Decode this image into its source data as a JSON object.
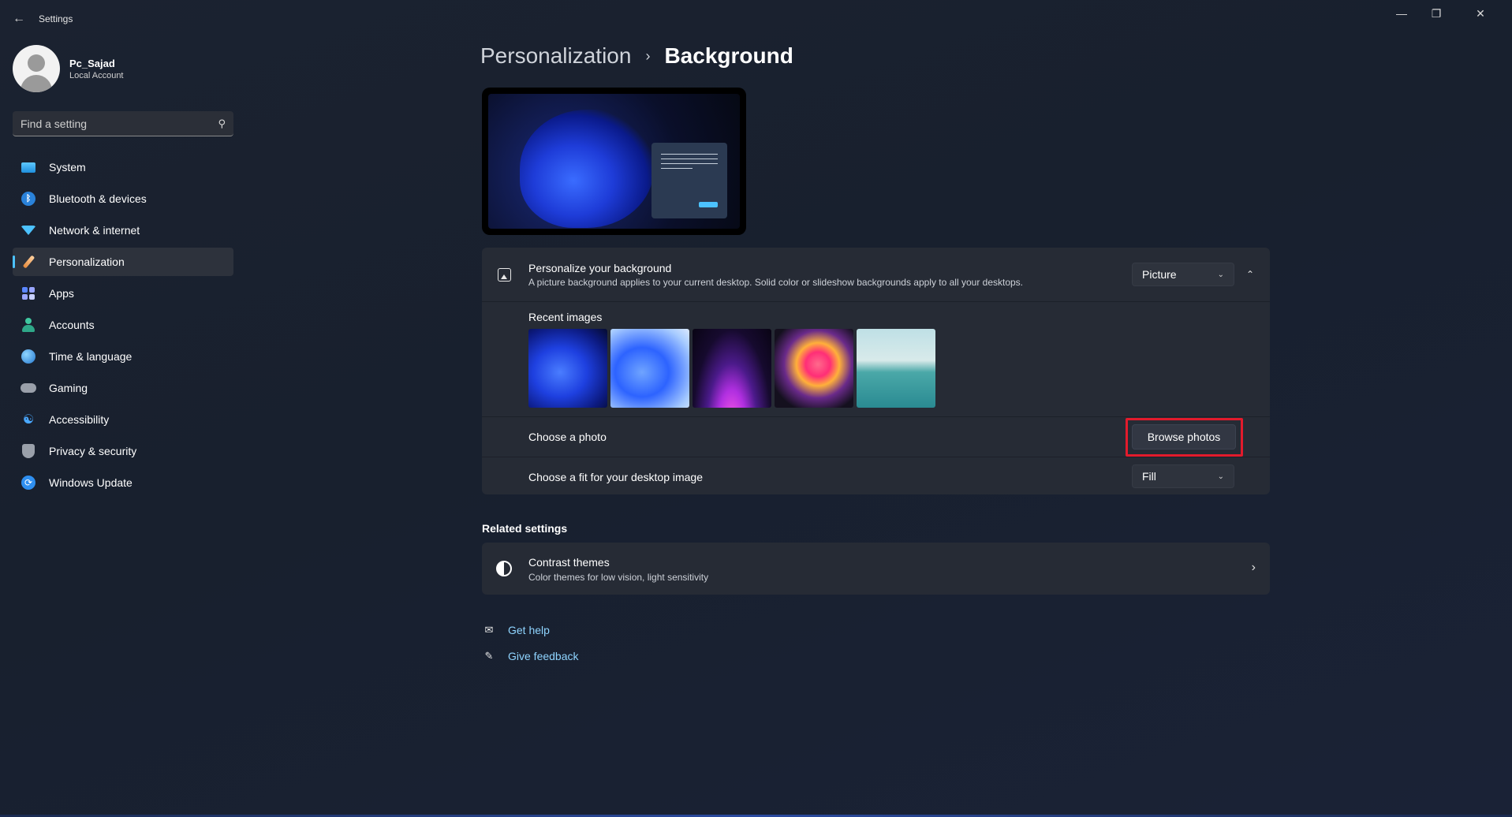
{
  "window": {
    "title": "Settings",
    "controls": {
      "minimize": "—",
      "maximize": "❐",
      "close": "✕"
    }
  },
  "profile": {
    "name": "Pc_Sajad",
    "account_type": "Local Account"
  },
  "search": {
    "placeholder": "Find a setting"
  },
  "sidebar": {
    "items": [
      {
        "label": "System",
        "icon": "system-icon"
      },
      {
        "label": "Bluetooth & devices",
        "icon": "bluetooth-icon"
      },
      {
        "label": "Network & internet",
        "icon": "wifi-icon"
      },
      {
        "label": "Personalization",
        "icon": "brush-icon",
        "active": true
      },
      {
        "label": "Apps",
        "icon": "apps-icon"
      },
      {
        "label": "Accounts",
        "icon": "person-icon"
      },
      {
        "label": "Time & language",
        "icon": "clock-globe-icon"
      },
      {
        "label": "Gaming",
        "icon": "gamepad-icon"
      },
      {
        "label": "Accessibility",
        "icon": "accessibility-icon"
      },
      {
        "label": "Privacy & security",
        "icon": "shield-icon"
      },
      {
        "label": "Windows Update",
        "icon": "update-icon"
      }
    ]
  },
  "breadcrumb": {
    "parent": "Personalization",
    "separator": "›",
    "current": "Background"
  },
  "background_card": {
    "title": "Personalize your background",
    "description": "A picture background applies to your current desktop. Solid color or slideshow backgrounds apply to all your desktops.",
    "selected_type": "Picture",
    "recent_images_label": "Recent images",
    "recent_images": [
      "bloom-blue-dark",
      "bloom-blue-light",
      "purple-glow",
      "pink-flower",
      "lake-sunrise"
    ],
    "choose_photo_label": "Choose a photo",
    "browse_button": "Browse photos",
    "fit_label": "Choose a fit for your desktop image",
    "fit_value": "Fill"
  },
  "related": {
    "title": "Related settings",
    "items": [
      {
        "title": "Contrast themes",
        "description": "Color themes for low vision, light sensitivity"
      }
    ]
  },
  "help_links": {
    "get_help": "Get help",
    "give_feedback": "Give feedback"
  },
  "colors": {
    "accent": "#4cc2ff",
    "highlight_box": "#e21b2c",
    "card_bg": "#262b35",
    "page_bg": "#1a2130"
  }
}
